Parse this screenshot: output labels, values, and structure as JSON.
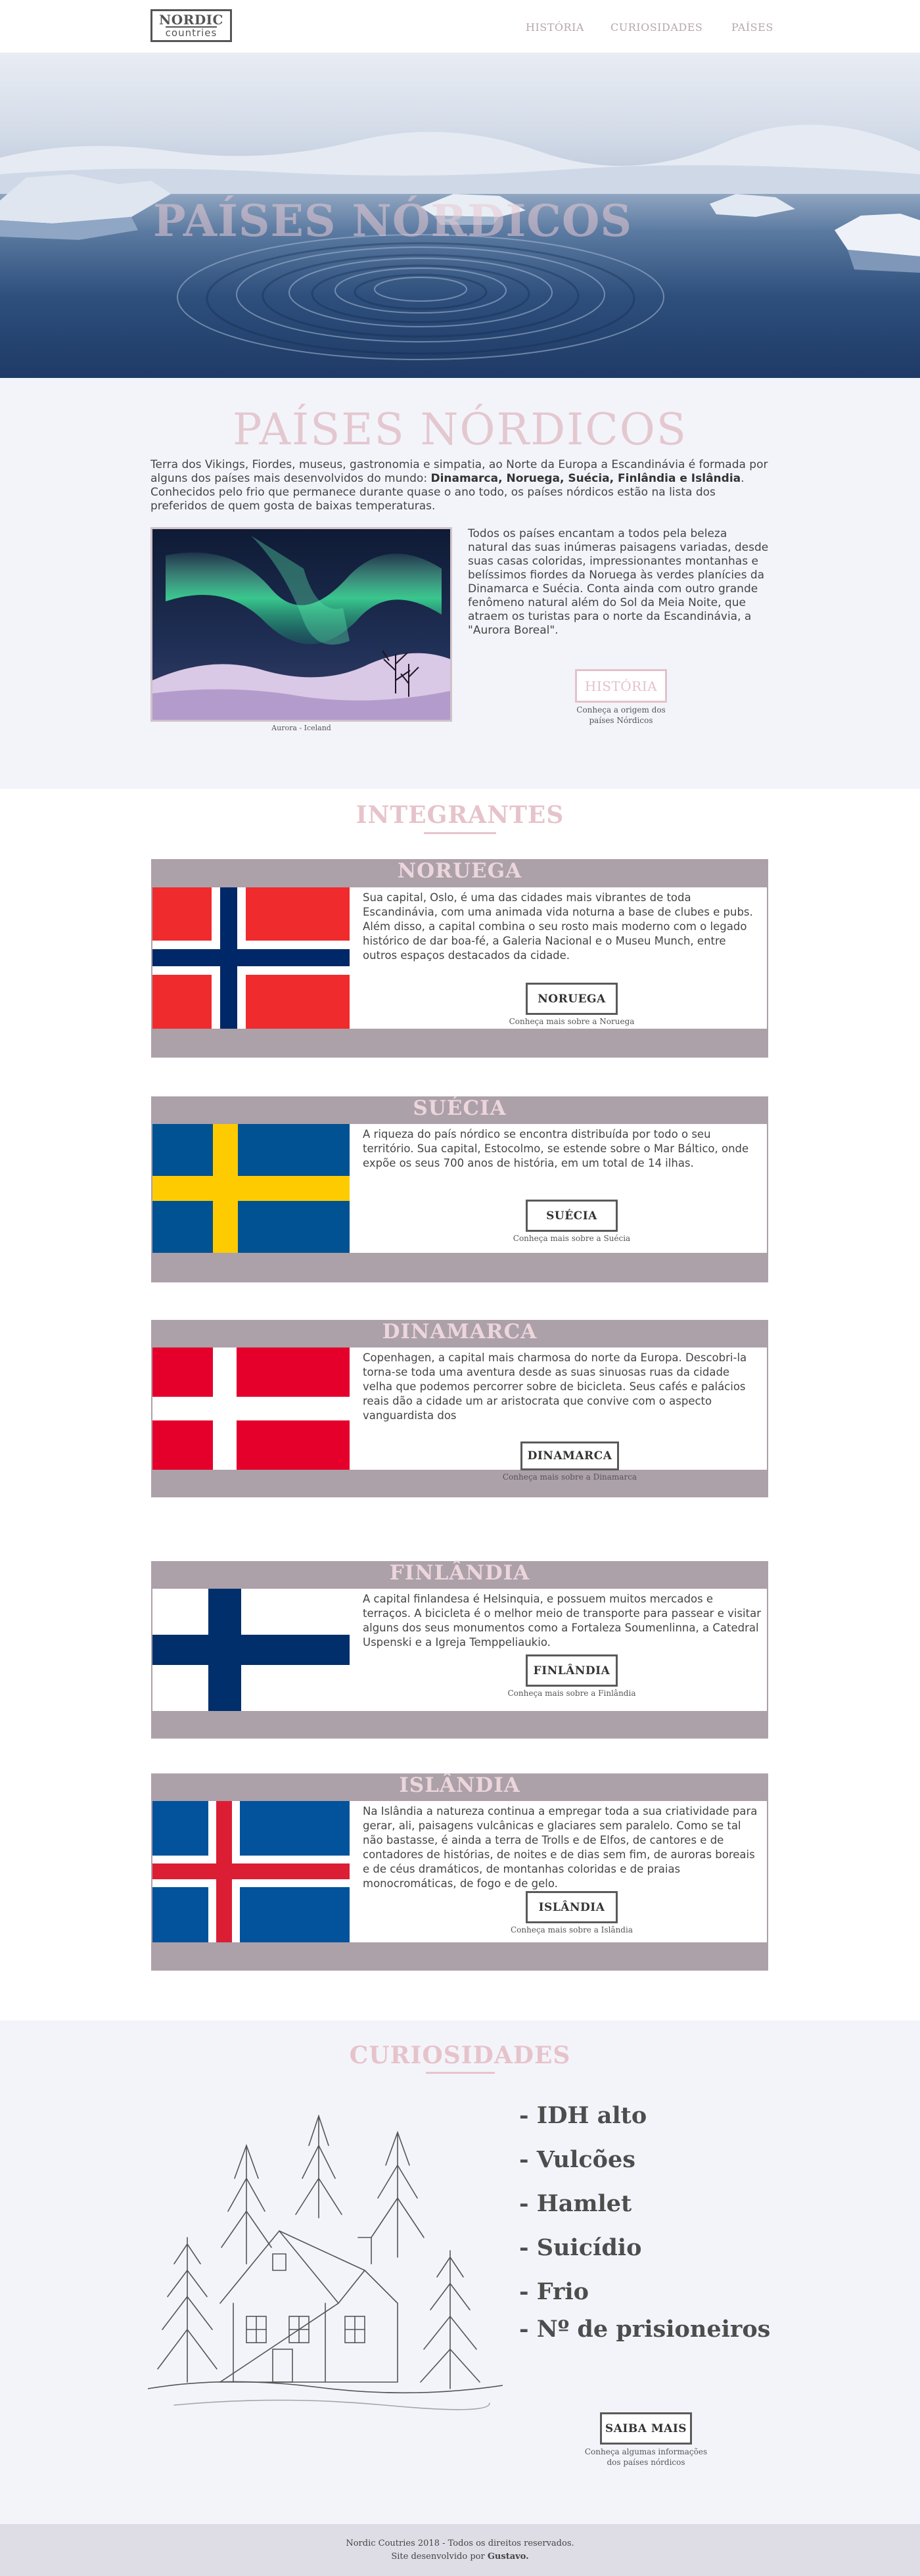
{
  "header": {
    "logo_line1": "NORDIC",
    "logo_line2": "countries",
    "nav": [
      {
        "label": "HISTÓRIA"
      },
      {
        "label": "CURIOSIDADES"
      },
      {
        "label": "PAÍSES"
      }
    ]
  },
  "hero": {
    "title": "PAÍSES NÓRDICOS"
  },
  "intro": {
    "title": "PAÍSES NÓRDICOS",
    "paragraph_before": "Terra dos Vikings, Fiordes, museus, gastronomia e simpatia, ao Norte da Europa a Escandinávia é formada por alguns dos países mais desenvolvidos do mundo: ",
    "paragraph_countries": "Dinamarca, Noruega, Suécia, Finlândia e Islândia",
    "paragraph_after": ". Conhecidos pelo frio que permanece durante quase o ano todo, os países nórdicos estão na lista dos preferidos de quem gosta de baixas temperaturas.",
    "side_text": "Todos os países encantam a todos pela beleza natural das suas inúmeras paisagens variadas, desde suas casas coloridas, impressionantes montanhas e belíssimos fiordes da Noruega às verdes planícies da Dinamarca e Suécia. Conta ainda com outro grande fenômeno natural além do Sol da Meia Noite, que atraem os turistas para o norte da Escandinávia, a \"Aurora Boreal\".",
    "photo_caption": "Aurora - Iceland",
    "button": "HISTÓRIA",
    "button_sub_line1": "Conheça a origem dos",
    "button_sub_line2": "países Nórdicos"
  },
  "integrantes": {
    "title": "INTEGRANTES"
  },
  "countries": [
    {
      "name": "NORUEGA",
      "text": "Sua capital, Oslo, é uma das cidades mais vibrantes de toda Escandinávia, com uma animada vida noturna a base de clubes e pubs. Além disso, a capital combina o seu rosto mais moderno com o legado histórico de dar boa-fé, a Galeria Nacional e o Museu Munch, entre outros espaços destacados da cidade.",
      "button": "NORUEGA",
      "sub": "Conheça mais sobre a Noruega",
      "flag": {
        "field": "#ef2b2d",
        "cross_outer": "#ffffff",
        "cross_inner": "#002868"
      }
    },
    {
      "name": "SUÉCIA",
      "text": "A riqueza do país nórdico se encontra distribuída por todo o seu território. Sua capital, Estocolmo, se estende sobre o Mar Báltico, onde expõe os seus 700 anos de história, em um total de 14 ilhas.",
      "button": "SUÉCIA",
      "sub": "Conheça mais sobre a Suécia",
      "flag": {
        "field": "#005293",
        "cross": "#fecb00"
      }
    },
    {
      "name": "DINAMARCA",
      "text": "Copenhagen, a capital mais charmosa do norte da Europa. Descobri-la torna-se toda uma aventura desde as suas sinuosas ruas da cidade velha que podemos percorrer sobre de bicicleta. Seus cafés e palácios reais dão a cidade um ar aristocrata que convive com o aspecto vanguardista dos",
      "button": "DINAMARCA",
      "sub": "Conheça mais sobre a Dinamarca",
      "flag": {
        "field": "#e4002b",
        "cross": "#ffffff"
      }
    },
    {
      "name": "FINLÂNDIA",
      "text": "A  capital finlandesa é Helsinquia, e possuem muitos mercados e terraços. A bicicleta é o melhor meio de transporte para passear e visitar alguns dos seus monumentos como a Fortaleza Soumenlinna, a Catedral Uspenski e a Igreja Temppeliaukio.",
      "button": "FINLÂNDIA",
      "sub": "Conheça mais sobre a Finlândia",
      "flag": {
        "field": "#ffffff",
        "cross": "#002f6c"
      }
    },
    {
      "name": "ISLÂNDIA",
      "text": "Na Islândia a natureza continua a empregar toda a sua criatividade para gerar, ali, paisagens vulcânicas e glaciares sem paralelo. Como se tal não bastasse, é ainda a terra de Trolls e de Elfos, de cantores e de contadores de histórias, de noites e de dias sem fim, de auroras boreais e de céus dramáticos, de montanhas coloridas e de praias monocromáticas, de fogo e de gelo.",
      "button": "ISLÂNDIA",
      "sub": "Conheça mais sobre a Islândia",
      "flag": {
        "field": "#02529c",
        "cross_outer": "#ffffff",
        "cross_inner": "#dc1e35"
      }
    }
  ],
  "curiosidades": {
    "title": "CURIOSIDADES",
    "items": [
      "- IDH alto",
      "- Vulcões",
      "- Hamlet",
      "- Suicídio",
      "- Frio",
      "- Nº de prisioneiros"
    ],
    "button": "SAIBA MAIS",
    "sub_line1": "Conheça algumas informações",
    "sub_line2": "dos países nórdicos"
  },
  "footer": {
    "line1": "Nordic Coutries 2018 - Todos os direitos reservados.",
    "line2_prefix": "Site desenvolvido por ",
    "line2_author": "Gustavo."
  }
}
